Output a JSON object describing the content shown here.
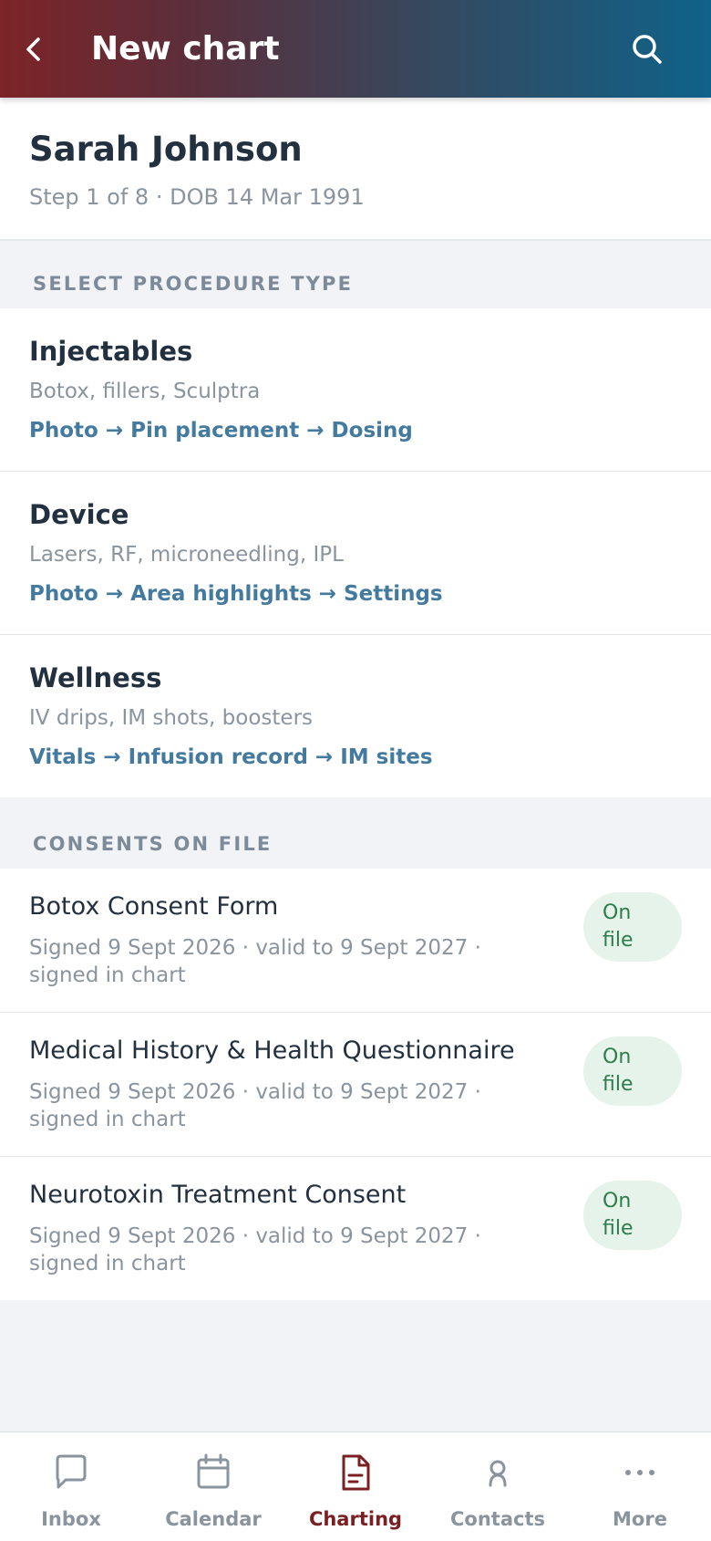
{
  "header": {
    "title": "New chart",
    "back_icon": "chevron-left-icon",
    "search_icon": "search-icon"
  },
  "patient": {
    "name": "Sarah Johnson",
    "subtitle": "Step 1 of 8 · DOB 14 Mar 1991"
  },
  "procedures": {
    "section_label": "SELECT PROCEDURE TYPE",
    "items": [
      {
        "title": "Injectables",
        "description": "Botox, fillers, Sculptra",
        "flow": "Photo → Pin placement → Dosing"
      },
      {
        "title": "Device",
        "description": "Lasers, RF, microneedling, IPL",
        "flow": "Photo → Area highlights → Settings"
      },
      {
        "title": "Wellness",
        "description": "IV drips, IM shots, boosters",
        "flow": "Vitals → Infusion record → IM sites"
      }
    ]
  },
  "consents": {
    "section_label": "CONSENTS ON FILE",
    "items": [
      {
        "title": "Botox Consent Form",
        "detail": "Signed 9 Sept 2026 · valid to 9 Sept 2027 · signed in chart",
        "badge_line1": "On",
        "badge_line2": "file"
      },
      {
        "title": "Medical History & Health Questionnaire",
        "detail": "Signed 9 Sept 2026 · valid to 9 Sept 2027 · signed in chart",
        "badge_line1": "On",
        "badge_line2": "file"
      },
      {
        "title": "Neurotoxin Treatment Consent",
        "detail": "Signed 9 Sept 2026 · valid to 9 Sept 2027 · signed in chart",
        "badge_line1": "On",
        "badge_line2": "file"
      }
    ]
  },
  "bottom_nav": {
    "items": [
      {
        "label": "Inbox",
        "icon": "chat-bubble-icon",
        "active": false
      },
      {
        "label": "Calendar",
        "icon": "calendar-icon",
        "active": false
      },
      {
        "label": "Charting",
        "icon": "document-icon",
        "active": true
      },
      {
        "label": "Contacts",
        "icon": "person-icon",
        "active": false
      },
      {
        "label": "More",
        "icon": "more-dots-icon",
        "active": false
      }
    ]
  },
  "colors": {
    "header_gradient_start": "#7c2427",
    "header_gradient_end": "#0f6289",
    "flow_link": "#437a9e",
    "badge_bg": "#e5f3ea",
    "badge_text": "#2c7d4b",
    "nav_active": "#7a1f22",
    "nav_inactive": "#8a949e"
  }
}
